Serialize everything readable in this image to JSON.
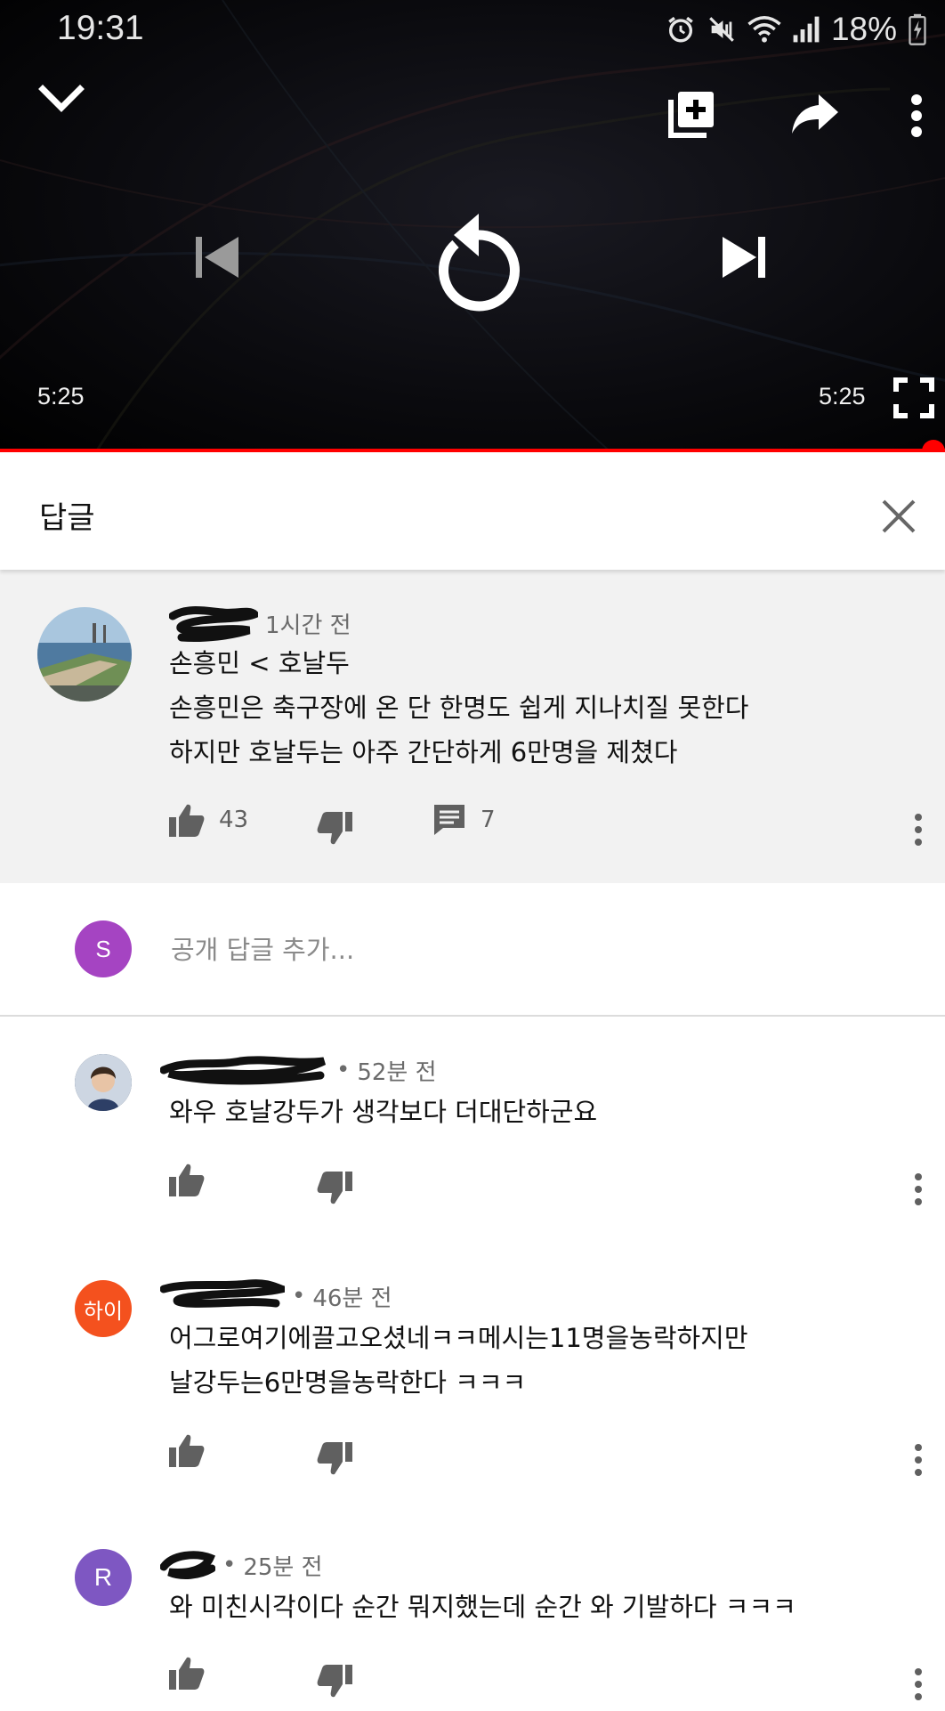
{
  "status_bar": {
    "time": "19:31",
    "battery": "18%"
  },
  "player": {
    "current_time": "5:25",
    "duration": "5:25",
    "progress_fraction": 1.0,
    "colors": {
      "accent": "#ff0000"
    }
  },
  "replies_panel": {
    "title": "답글"
  },
  "parent_comment": {
    "timestamp": "1시간 전",
    "lines": [
      "손흥민 < 호날두",
      "손흥민은 축구장에 온 단 한명도 쉽게 지나치질 못한다",
      "하지만 호날두는 아주 간단하게 6만명을 제쳤다"
    ],
    "likes": "43",
    "reply_count": "7"
  },
  "add_reply": {
    "avatar_letter": "S",
    "placeholder": "공개 답글 추가..."
  },
  "replies": [
    {
      "timestamp": "52분 전",
      "lines": [
        "와우 호날강두가 생각보다 더대단하군요"
      ]
    },
    {
      "avatar_text": "하이",
      "timestamp": "46분 전",
      "lines": [
        "어그로여기에끌고오셨네ㅋㅋ메시는11명을농락하지만",
        "날강두는6만명을농락한다 ㅋㅋㅋ"
      ]
    },
    {
      "avatar_letter": "R",
      "timestamp": "25분 전",
      "lines": [
        "와 미친시각이다 순간 뭐지했는데 순간 와 기발하다 ㅋㅋㅋ"
      ]
    }
  ]
}
